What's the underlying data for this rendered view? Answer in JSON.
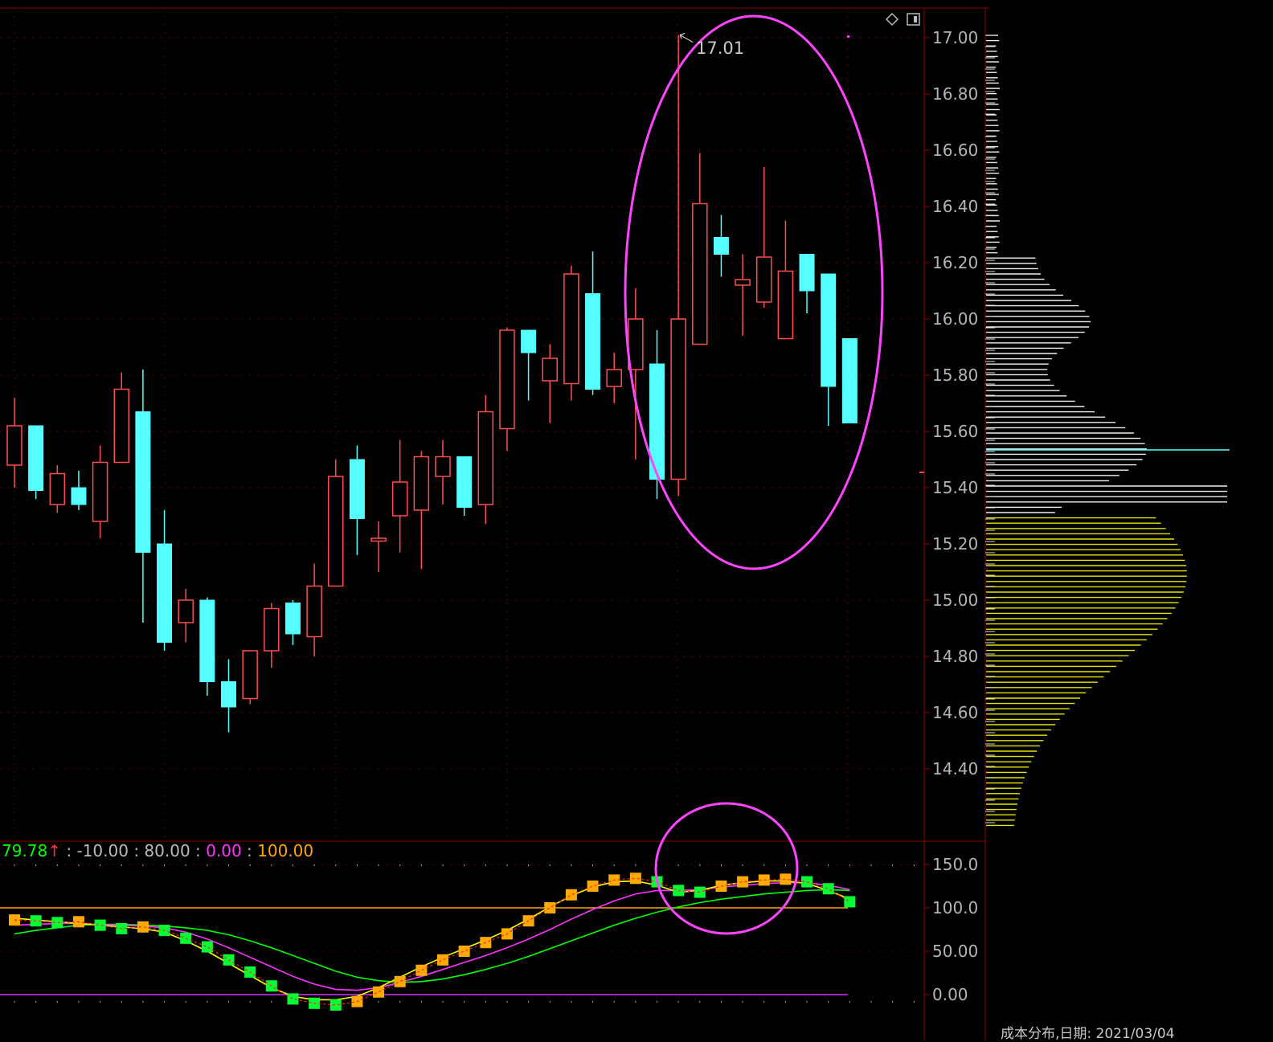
{
  "colors": {
    "up": "#ff4d4d",
    "down": "#55ffff",
    "grid": "#6e0000",
    "ellipse": "#ff44ff",
    "k_line": "#ffff00",
    "d_line": "#ff33ff",
    "j_line": "#00ff00",
    "line_100": "#ffa500",
    "line_0": "#cc33ff",
    "bar_up": "#ffaa00",
    "bar_down": "#00ff33",
    "dist_upper": "#f0f0f0",
    "dist_lower": "#e6e600",
    "dist_mark": "#55ffff"
  },
  "chart_data": {
    "type": "candlestick",
    "y_ticks": [
      "17.00",
      "16.80",
      "16.60",
      "16.40",
      "16.20",
      "16.00",
      "15.80",
      "15.60",
      "15.40",
      "15.20",
      "15.00",
      "14.80",
      "14.60",
      "14.40"
    ],
    "y_tick_values": [
      17.0,
      16.8,
      16.6,
      16.4,
      16.2,
      16.0,
      15.8,
      15.6,
      15.4,
      15.2,
      15.0,
      14.8,
      14.6,
      14.4
    ],
    "high_annotation": "17.01",
    "candles": [
      {
        "o": 15.48,
        "h": 15.72,
        "l": 15.4,
        "c": 15.62
      },
      {
        "o": 15.62,
        "h": 15.62,
        "l": 15.36,
        "c": 15.39
      },
      {
        "o": 15.34,
        "h": 15.48,
        "l": 15.31,
        "c": 15.45
      },
      {
        "o": 15.4,
        "h": 15.46,
        "l": 15.32,
        "c": 15.34
      },
      {
        "o": 15.28,
        "h": 15.55,
        "l": 15.22,
        "c": 15.49
      },
      {
        "o": 15.49,
        "h": 15.81,
        "l": 15.49,
        "c": 15.75
      },
      {
        "o": 15.67,
        "h": 15.82,
        "l": 14.92,
        "c": 15.17
      },
      {
        "o": 15.2,
        "h": 15.32,
        "l": 14.82,
        "c": 14.85
      },
      {
        "o": 14.92,
        "h": 15.04,
        "l": 14.85,
        "c": 15.0
      },
      {
        "o": 15.0,
        "h": 15.01,
        "l": 14.66,
        "c": 14.71
      },
      {
        "o": 14.71,
        "h": 14.79,
        "l": 14.53,
        "c": 14.62
      },
      {
        "o": 14.65,
        "h": 14.82,
        "l": 14.63,
        "c": 14.82
      },
      {
        "o": 14.82,
        "h": 14.99,
        "l": 14.76,
        "c": 14.97
      },
      {
        "o": 14.99,
        "h": 15.0,
        "l": 14.84,
        "c": 14.88
      },
      {
        "o": 14.87,
        "h": 15.13,
        "l": 14.8,
        "c": 15.05
      },
      {
        "o": 15.05,
        "h": 15.5,
        "l": 15.05,
        "c": 15.44
      },
      {
        "o": 15.5,
        "h": 15.55,
        "l": 15.16,
        "c": 15.29
      },
      {
        "o": 15.21,
        "h": 15.28,
        "l": 15.1,
        "c": 15.22
      },
      {
        "o": 15.3,
        "h": 15.57,
        "l": 15.17,
        "c": 15.42
      },
      {
        "o": 15.32,
        "h": 15.53,
        "l": 15.11,
        "c": 15.51
      },
      {
        "o": 15.44,
        "h": 15.57,
        "l": 15.34,
        "c": 15.51
      },
      {
        "o": 15.51,
        "h": 15.51,
        "l": 15.3,
        "c": 15.33
      },
      {
        "o": 15.34,
        "h": 15.73,
        "l": 15.27,
        "c": 15.67
      },
      {
        "o": 15.61,
        "h": 15.97,
        "l": 15.53,
        "c": 15.96
      },
      {
        "o": 15.96,
        "h": 15.96,
        "l": 15.71,
        "c": 15.88
      },
      {
        "o": 15.78,
        "h": 15.91,
        "l": 15.63,
        "c": 15.86
      },
      {
        "o": 15.77,
        "h": 16.19,
        "l": 15.71,
        "c": 16.16
      },
      {
        "o": 16.09,
        "h": 16.24,
        "l": 15.73,
        "c": 15.75
      },
      {
        "o": 15.76,
        "h": 15.88,
        "l": 15.7,
        "c": 15.82
      },
      {
        "o": 15.82,
        "h": 16.11,
        "l": 15.5,
        "c": 16.0
      },
      {
        "o": 15.84,
        "h": 15.96,
        "l": 15.36,
        "c": 15.43
      },
      {
        "o": 15.43,
        "h": 17.01,
        "l": 15.37,
        "c": 16.0
      },
      {
        "o": 15.91,
        "h": 16.59,
        "l": 15.91,
        "c": 16.41
      },
      {
        "o": 16.29,
        "h": 16.37,
        "l": 16.15,
        "c": 16.23
      },
      {
        "o": 16.12,
        "h": 16.23,
        "l": 15.94,
        "c": 16.14
      },
      {
        "o": 16.06,
        "h": 16.54,
        "l": 16.04,
        "c": 16.22
      },
      {
        "o": 15.93,
        "h": 16.35,
        "l": 15.93,
        "c": 16.17
      },
      {
        "o": 16.23,
        "h": 16.23,
        "l": 16.02,
        "c": 16.1
      },
      {
        "o": 16.16,
        "h": 16.16,
        "l": 15.62,
        "c": 15.76
      },
      {
        "o": 15.93,
        "h": 15.93,
        "l": 15.63,
        "c": 15.63
      }
    ],
    "indicator": {
      "y_ticks": [
        "150.0",
        "100.0",
        "50.00",
        "0.00"
      ],
      "y_tick_values": [
        150,
        100,
        50,
        0
      ],
      "ref_lines": [
        100,
        0
      ],
      "bars": [
        86,
        85,
        83,
        84,
        80,
        76,
        78,
        74,
        65,
        55,
        40,
        26,
        10,
        -5,
        -10,
        -12,
        -8,
        3,
        15,
        28,
        40,
        50,
        60,
        70,
        85,
        100,
        115,
        125,
        132,
        134,
        130,
        120,
        118,
        125,
        130,
        132,
        133,
        130,
        122,
        107
      ],
      "k": [
        88,
        86,
        84,
        82,
        80,
        78,
        76,
        72,
        62,
        50,
        36,
        22,
        8,
        -2,
        -6,
        -6,
        -2,
        8,
        20,
        32,
        43,
        53,
        63,
        74,
        87,
        101,
        114,
        124,
        130,
        131,
        126,
        118,
        120,
        126,
        129,
        131,
        131,
        128,
        120,
        110
      ],
      "d": [
        80,
        81,
        82,
        82,
        81,
        80,
        79,
        77,
        72,
        64,
        54,
        43,
        32,
        21,
        12,
        6,
        5,
        8,
        14,
        21,
        29,
        37,
        45,
        54,
        64,
        75,
        87,
        98,
        108,
        116,
        120,
        120,
        121,
        124,
        126,
        128,
        129,
        129,
        126,
        121
      ],
      "j": [
        70,
        74,
        77,
        80,
        81,
        81,
        80,
        79,
        77,
        74,
        69,
        62,
        54,
        45,
        36,
        27,
        20,
        16,
        14,
        15,
        18,
        23,
        29,
        36,
        44,
        53,
        62,
        71,
        80,
        88,
        95,
        101,
        106,
        110,
        113,
        116,
        118,
        120,
        121,
        120
      ]
    }
  },
  "indicator_legend": {
    "value": "79.78",
    "arrow": "↑",
    "sep": " : ",
    "p1": "-10.00",
    "p2": "80.00",
    "p3": "0.00",
    "p4": "100.00"
  },
  "status": {
    "text": "成本分布,日期: 2021/03/04"
  }
}
